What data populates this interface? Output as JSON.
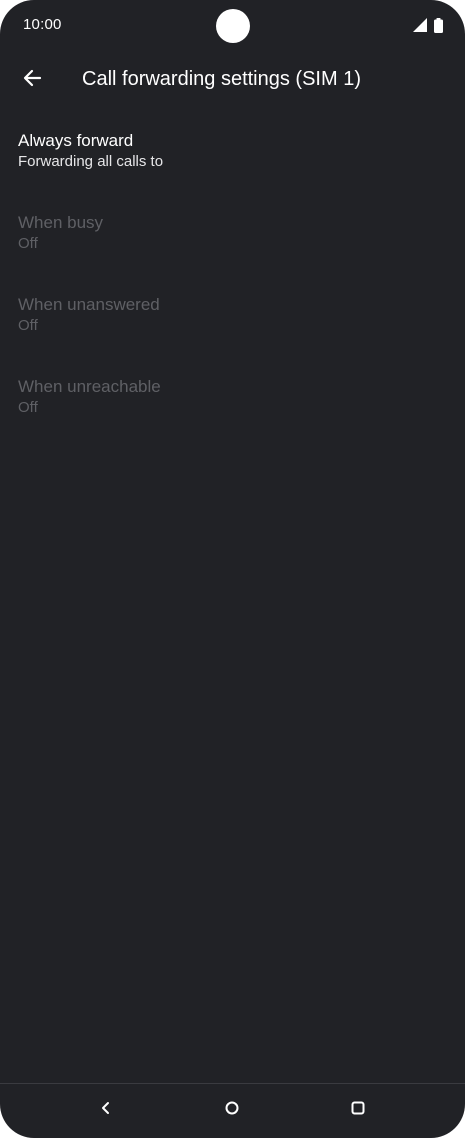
{
  "status_bar": {
    "time": "10:00",
    "icons": [
      "camera-cutout",
      "signal-icon",
      "battery-icon"
    ]
  },
  "app_bar": {
    "back_icon": "arrow-back-icon",
    "title": "Call forwarding settings (SIM 1)"
  },
  "settings": {
    "items": [
      {
        "title": "Always forward",
        "summary": "Forwarding all calls to",
        "enabled": true
      },
      {
        "title": "When busy",
        "summary": "Off",
        "enabled": false
      },
      {
        "title": "When unanswered",
        "summary": "Off",
        "enabled": false
      },
      {
        "title": "When unreachable",
        "summary": "Off",
        "enabled": false
      }
    ]
  },
  "nav_bar": {
    "icons": [
      "nav-back-icon",
      "nav-home-icon",
      "nav-recents-icon"
    ]
  },
  "colors": {
    "background": "#212226",
    "text_primary": "#ffffff",
    "text_disabled": "#5f6065"
  }
}
